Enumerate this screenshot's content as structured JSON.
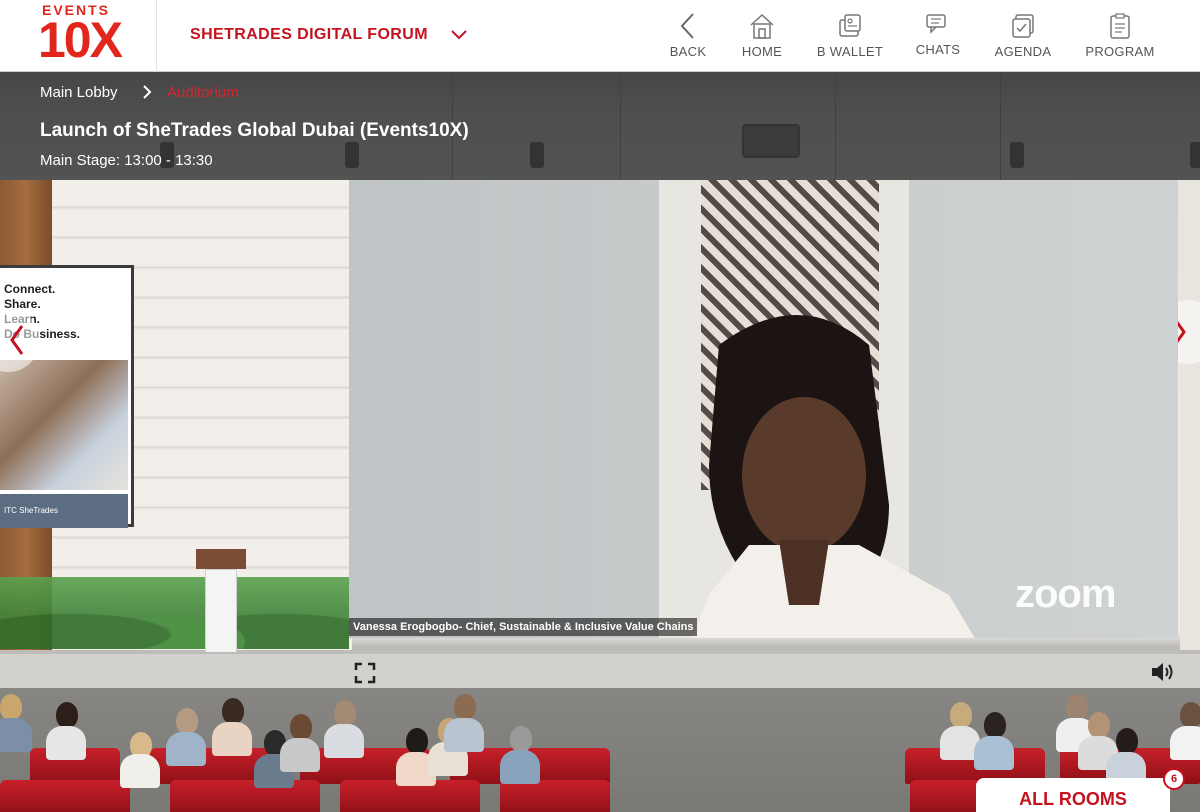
{
  "brand": {
    "logo_top": "EVENTS",
    "logo_main": "10X",
    "accent": "#c4121f"
  },
  "event": {
    "title": "SHETRADES DIGITAL FORUM"
  },
  "nav": {
    "back": "BACK",
    "home": "HOME",
    "wallet": "B WALLET",
    "chats": "CHATS",
    "agenda": "AGENDA",
    "program": "PROGRAM"
  },
  "breadcrumb": {
    "lobby": "Main Lobby",
    "current": "Auditorium"
  },
  "session": {
    "title": "Launch of SheTrades Global Dubai (Events10X)",
    "time": "Main Stage: 13:00 - 13:30"
  },
  "poster": {
    "tagline": "Connect.\nShare.\nLearn.\nDo Business.",
    "footer": "ITC  SheTrades"
  },
  "video": {
    "caption": "Vanessa Erogbogbo- Chief, Sustainable & Inclusive Value Chains",
    "watermark": "zoom"
  },
  "rooms": {
    "label": "ALL ROOMS",
    "count": "6"
  }
}
